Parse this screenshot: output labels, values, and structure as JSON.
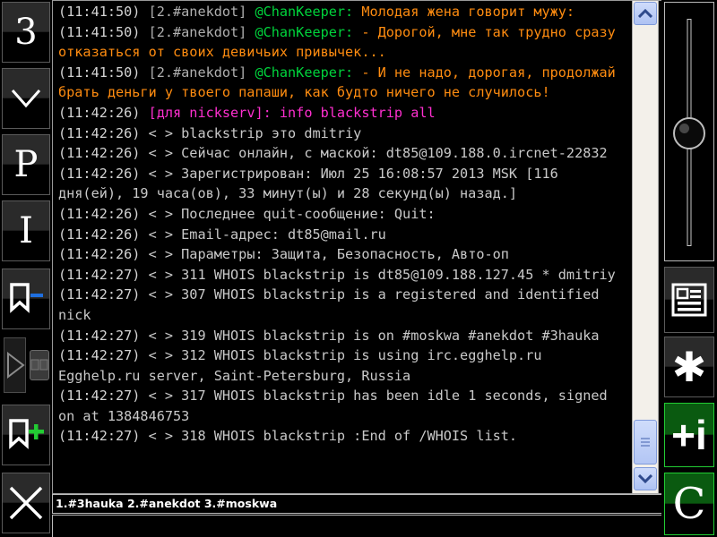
{
  "left_toolbar": {
    "buttons": [
      {
        "name": "channel-number-button",
        "icon": "digit-3",
        "label": "3"
      },
      {
        "name": "scroll-down-button",
        "icon": "chevron-down-icon",
        "label": "⌄"
      },
      {
        "name": "private-messages-button",
        "icon": "letter-p",
        "label": "P"
      },
      {
        "name": "info-button",
        "icon": "letter-i",
        "label": "I"
      },
      {
        "name": "bookmark-minus-button",
        "icon": "bookmark-minus-icon",
        "label": ""
      },
      {
        "name": "play-button",
        "icon": "play-icon",
        "label": ""
      },
      {
        "name": "pause-button",
        "icon": "pause-icon",
        "label": ""
      },
      {
        "name": "bookmark-plus-button",
        "icon": "bookmark-plus-icon",
        "label": ""
      },
      {
        "name": "close-button",
        "icon": "close-x-icon",
        "label": "×"
      }
    ]
  },
  "right_toolbar": {
    "slider": {
      "name": "vertical-slider",
      "value_position_pct": 47
    },
    "buttons": [
      {
        "name": "list-view-button",
        "icon": "list-panel-icon",
        "label": ""
      },
      {
        "name": "asterisk-button",
        "icon": "asterisk-icon",
        "label": "✱"
      },
      {
        "name": "add-info-button",
        "icon": "plus-i-icon",
        "label": "+i"
      },
      {
        "name": "connect-button",
        "icon": "letter-c",
        "label": "C"
      }
    ]
  },
  "scrollbar": {
    "name": "vertical-scrollbar",
    "up_arrow": "chevron-up-icon",
    "down_arrow": "chevron-down-icon",
    "thumb": "scrollbar-thumb",
    "position_pct": 88
  },
  "statusbar": {
    "text": "1.#3hauka 2.#anekdot 3.#moskwa",
    "channels": [
      "1.#3hauka",
      "2.#anekdot",
      "3.#moskwa"
    ]
  },
  "input": {
    "value": "",
    "placeholder": ""
  },
  "chat": {
    "lines": [
      {
        "ts": "(11:41:50)",
        "chan": "[2.#anekdot]",
        "nick": "@ChanKeeper:",
        "msg": "Молодая жена говорит мужу:"
      },
      {
        "ts": "(11:41:50)",
        "chan": "[2.#anekdot]",
        "nick": "@ChanKeeper:",
        "msg": "- Дорогой, мне так трудно сразу отказаться от своих девичьих привычек..."
      },
      {
        "ts": "(11:41:50)",
        "chan": "[2.#anekdot]",
        "nick": "@ChanKeeper:",
        "msg": "- И не надо, дорогая, продолжай брать деньги у твоего папаши, как будто ничего не случилось!"
      },
      {
        "ts": "(11:42:26)",
        "cmd": "[для nickserv]: info blackstrip all"
      },
      {
        "ts": "(11:42:26)",
        "srv": "< > blackstrip это dmitriy"
      },
      {
        "ts": "(11:42:26)",
        "srv": "< > Сейчас онлайн, с маской: dt85@109.188.0.ircnet-22832"
      },
      {
        "ts": "(11:42:26)",
        "srv": "< > Зарегистрирован: Июл 25 16:08:57 2013 MSK [116 дня(ей), 19 часа(ов), 33 минут(ы) и 28 секунд(ы) назад.]"
      },
      {
        "ts": "(11:42:26)",
        "srv": "< > Последнее quit-сообщение: Quit:"
      },
      {
        "ts": "(11:42:26)",
        "srv": "< > Email-адрес: dt85@mail.ru"
      },
      {
        "ts": "(11:42:26)",
        "srv": "< > Параметры: Защита, Безопасность, Авто-оп"
      },
      {
        "ts": "(11:42:27)",
        "srv": "< > 311 WHOIS blackstrip is dt85@109.188.127.45 * dmitriy"
      },
      {
        "ts": "(11:42:27)",
        "srv": "< > 307 WHOIS blackstrip is a registered and identified nick"
      },
      {
        "ts": "(11:42:27)",
        "srv": "< > 319 WHOIS blackstrip is on #moskwa #anekdot #3hauka"
      },
      {
        "ts": "(11:42:27)",
        "srv": "< > 312 WHOIS blackstrip is using irc.egghelp.ru Egghelp.ru server, Saint-Petersburg, Russia"
      },
      {
        "ts": "(11:42:27)",
        "srv": "< > 317 WHOIS blackstrip has been idle 1 seconds, signed on at 1384846753"
      },
      {
        "ts": "(11:42:27)",
        "srv": "< > 318 WHOIS blackstrip :End of /WHOIS list."
      }
    ]
  },
  "colors": {
    "background": "#000000",
    "timestamp": "#d4d4d4",
    "channel": "#b0b0b0",
    "nick": "#00d43c",
    "message": "#ff8c10",
    "command": "#ff2fd0",
    "server": "#c9c9c9",
    "accent_green": "#22cc33",
    "scrollbar_blue": "#aec2f3"
  }
}
